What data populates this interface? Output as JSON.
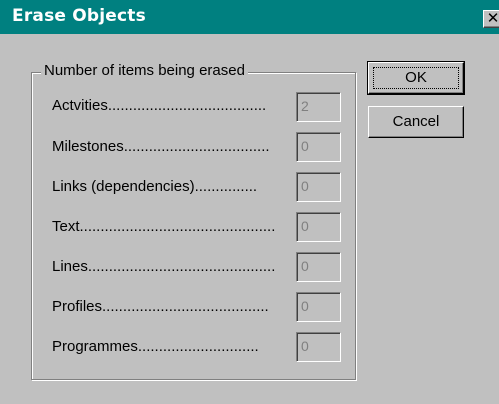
{
  "window": {
    "title": "Erase Objects",
    "close_label": "✕"
  },
  "group": {
    "legend": "Number of items being erased"
  },
  "rows": [
    {
      "label": "Actvities......................................",
      "value": "2"
    },
    {
      "label": "Milestones...................................",
      "value": "0"
    },
    {
      "label": "Links (dependencies)...............",
      "value": "0"
    },
    {
      "label": "Text...............................................",
      "value": "0"
    },
    {
      "label": "Lines.............................................",
      "value": "0"
    },
    {
      "label": "Profiles........................................",
      "value": "0"
    },
    {
      "label": "Programmes.............................",
      "value": "0"
    }
  ],
  "buttons": {
    "ok": "OK",
    "cancel": "Cancel"
  },
  "colors": {
    "titlebar": "#008080",
    "face": "#c0c0c0",
    "disabled_text": "#808080"
  }
}
